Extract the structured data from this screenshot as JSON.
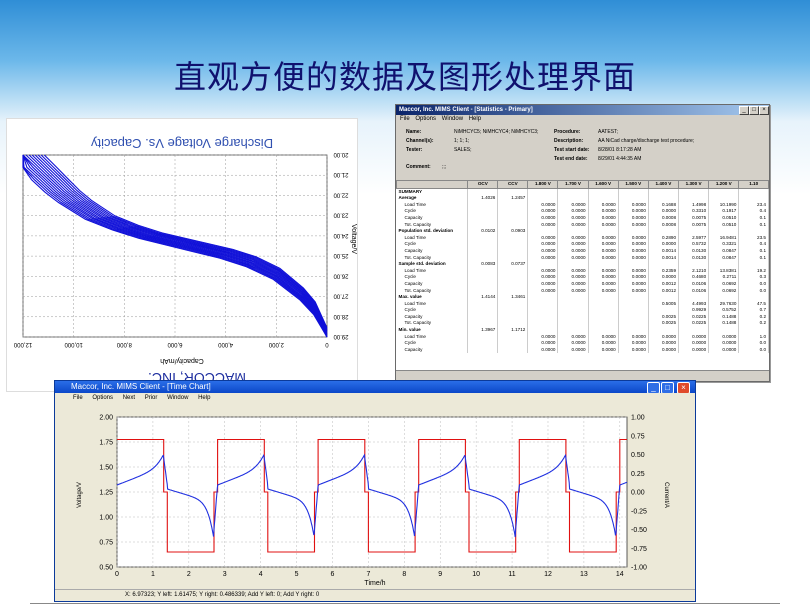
{
  "slide": {
    "title": "直观方便的数据及图形处理界面"
  },
  "discharge": {
    "title": "Discharge Voltage Vs. Capacity",
    "xlabel": "Capacity/mAh",
    "ylabel": "Voltage/V",
    "xticks": [
      "0",
      "2,000",
      "4,000",
      "6,000",
      "8,000",
      "10,000",
      "12,000"
    ],
    "yticks": [
      "20.00",
      "21.00",
      "22.00",
      "23.00",
      "24.00",
      "25.00",
      "26.00",
      "27.00",
      "28.00",
      "29.00"
    ],
    "watermark": "MACCOR, INC.",
    "line_color": "#1010d8"
  },
  "stats": {
    "window_title": "Maccor, Inc. MIMS Client - [Statistics - Primary]",
    "menu": [
      "File",
      "Options",
      "Window",
      "Help"
    ],
    "name_label": "Name:",
    "name_value": "NiMHCYC5; NiMHCYC4; NiMHCYC3;",
    "channels_label": "Channel(s):",
    "channels_value": "1; 1; 1;",
    "tester_label": "Tester:",
    "tester_value": "SALES;",
    "comment_label": "Comment:",
    "comment_value": ";;;",
    "procedure_label": "Procedure:",
    "procedure_value": "AATEST;",
    "description_label": "Description:",
    "description_value": "AA NiCad charge/discharge test procedure;",
    "start_label": "Test start date:",
    "start_value": "8/28/01 8:17:28 AM",
    "end_label": "Test end date:",
    "end_value": "8/29/01 4:44:35 AM",
    "columns": [
      "",
      "OCV",
      "CCV",
      "1.800 V",
      "1.700 V",
      "1.600 V",
      "1.500 V",
      "1.400 V",
      "1.300 V",
      "1.200 V",
      "1.10"
    ],
    "rows": [
      {
        "label": "SUMMARY",
        "sec": true,
        "cells": [
          "",
          "",
          "",
          "",
          "",
          "",
          "",
          "",
          "",
          ""
        ]
      },
      {
        "label": "Average",
        "sec": true,
        "cells": [
          "1.4026",
          "1.2457",
          "",
          "",
          "",
          "",
          "",
          "",
          "",
          ""
        ]
      },
      {
        "label": "Load Time",
        "cells": [
          "",
          "",
          "0.0000",
          "0.0000",
          "0.0000",
          "0.0000",
          "0.1688",
          "1.4998",
          "10.1990",
          "23.4"
        ]
      },
      {
        "label": "Cycle",
        "cells": [
          "",
          "",
          "0.0000",
          "0.0000",
          "0.0000",
          "0.0000",
          "0.0000",
          "0.3310",
          "0.1917",
          "0.4"
        ]
      },
      {
        "label": "Capacity",
        "cells": [
          "",
          "",
          "0.0000",
          "0.0000",
          "0.0000",
          "0.0000",
          "0.0008",
          "0.0075",
          "0.0510",
          "0.1"
        ]
      },
      {
        "label": "Tot. Capacity",
        "cells": [
          "",
          "",
          "0.0000",
          "0.0000",
          "0.0000",
          "0.0000",
          "0.0008",
          "0.0075",
          "0.0510",
          "0.1"
        ]
      },
      {
        "label": "Population std. deviation",
        "sec": true,
        "cells": [
          "0.0102",
          "0.0903",
          "",
          "",
          "",
          "",
          "",
          "",
          "",
          ""
        ]
      },
      {
        "label": "Load Time",
        "cells": [
          "",
          "",
          "0.0000",
          "0.0000",
          "0.0000",
          "0.0000",
          "0.2890",
          "2.5977",
          "16.9481",
          "23.5"
        ]
      },
      {
        "label": "Cycle",
        "cells": [
          "",
          "",
          "0.0000",
          "0.0000",
          "0.0000",
          "0.0000",
          "0.0000",
          "0.5732",
          "0.3321",
          "0.4"
        ]
      },
      {
        "label": "Capacity",
        "cells": [
          "",
          "",
          "0.0000",
          "0.0000",
          "0.0000",
          "0.0000",
          "0.0014",
          "0.0130",
          "0.0847",
          "0.1"
        ]
      },
      {
        "label": "Tot. Capacity",
        "cells": [
          "",
          "",
          "0.0000",
          "0.0000",
          "0.0000",
          "0.0000",
          "0.0014",
          "0.0130",
          "0.0847",
          "0.1"
        ]
      },
      {
        "label": "Sample std. deviation",
        "sec": true,
        "cells": [
          "0.0083",
          "0.0737",
          "",
          "",
          "",
          "",
          "",
          "",
          "",
          ""
        ]
      },
      {
        "label": "Load Time",
        "cells": [
          "",
          "",
          "0.0000",
          "0.0000",
          "0.0000",
          "0.0000",
          "0.2359",
          "2.1210",
          "13.8381",
          "19.2"
        ]
      },
      {
        "label": "Cycle",
        "cells": [
          "",
          "",
          "0.0000",
          "0.0000",
          "0.0000",
          "0.0000",
          "0.0000",
          "0.4680",
          "0.2711",
          "0.3"
        ]
      },
      {
        "label": "Capacity",
        "cells": [
          "",
          "",
          "0.0000",
          "0.0000",
          "0.0000",
          "0.0000",
          "0.0012",
          "0.0106",
          "0.0692",
          "0.0"
        ]
      },
      {
        "label": "Tot. Capacity",
        "cells": [
          "",
          "",
          "0.0000",
          "0.0000",
          "0.0000",
          "0.0000",
          "0.0012",
          "0.0106",
          "0.0692",
          "0.0"
        ]
      },
      {
        "label": "Max. value",
        "sec": true,
        "cells": [
          "1.4144",
          "1.3461",
          "",
          "",
          "",
          "",
          "",
          "",
          "",
          ""
        ]
      },
      {
        "label": "Load Time",
        "cells": [
          "",
          "",
          "",
          "",
          "",
          "",
          "0.5005",
          "4.4993",
          "29.7630",
          "47.5"
        ]
      },
      {
        "label": "Cycle",
        "cells": [
          "",
          "",
          "",
          "",
          "",
          "",
          "",
          "0.9929",
          "0.5752",
          "0.7"
        ]
      },
      {
        "label": "Capacity",
        "cells": [
          "",
          "",
          "",
          "",
          "",
          "",
          "0.0025",
          "0.0225",
          "0.1488",
          "0.2"
        ]
      },
      {
        "label": "Tot. Capacity",
        "cells": [
          "",
          "",
          "",
          "",
          "",
          "",
          "0.0025",
          "0.0225",
          "0.1488",
          "0.2"
        ]
      },
      {
        "label": "Min. value",
        "sec": true,
        "cells": [
          "1.3967",
          "1.1712",
          "",
          "",
          "",
          "",
          "",
          "",
          "",
          ""
        ]
      },
      {
        "label": "Load Time",
        "cells": [
          "",
          "",
          "0.0000",
          "0.0000",
          "0.0000",
          "0.0000",
          "0.0000",
          "0.0000",
          "0.0000",
          "1.0"
        ]
      },
      {
        "label": "Cycle",
        "cells": [
          "",
          "",
          "0.0000",
          "0.0000",
          "0.0000",
          "0.0000",
          "0.0000",
          "0.0000",
          "0.0000",
          "0.0"
        ]
      },
      {
        "label": "Capacity",
        "cells": [
          "",
          "",
          "0.0000",
          "0.0000",
          "0.0000",
          "0.0000",
          "0.0000",
          "0.0000",
          "0.0000",
          "0.0"
        ]
      }
    ]
  },
  "timechart": {
    "window_title": "Maccor, Inc. MIMS Client - [Time Chart]",
    "menu": [
      "File",
      "Options",
      "Next",
      "Prior",
      "Window",
      "Help"
    ],
    "status": "X: 6.97323; Y left: 1.61475; Y right: 0.486339; Add Y left: 0; Add Y right: 0",
    "xlabel": "Time/h",
    "ylabel_left": "Voltage/V",
    "ylabel_right": "Current/A",
    "xticks": [
      "0",
      "1",
      "2",
      "3",
      "4",
      "5",
      "6",
      "7",
      "8",
      "9",
      "10",
      "11",
      "12",
      "13",
      "14"
    ],
    "yleft_ticks": [
      "2.00",
      "1.75",
      "1.50",
      "1.25",
      "1.00",
      "0.75",
      "0.50"
    ],
    "yright_ticks": [
      "1.00",
      "0.75",
      "0.50",
      "0.25",
      "0.00",
      "-0.25",
      "-0.50",
      "-0.75",
      "-1.00"
    ],
    "voltage_color": "#2030e0",
    "current_color": "#e01010"
  },
  "chart_data": [
    {
      "type": "line",
      "title": "Discharge Voltage Vs. Capacity",
      "xlabel": "Capacity/mAh",
      "ylabel": "Voltage/V",
      "xlim": [
        12000,
        0
      ],
      "ylim": [
        20,
        29
      ],
      "series": [
        {
          "x": [
            0,
            500,
            1000,
            2000,
            3000,
            4000,
            5000,
            6000,
            7000,
            8000,
            9000,
            10000,
            10500,
            11000,
            11500,
            12000
          ],
          "values": [
            28.9,
            27.6,
            26.9,
            25.9,
            25.3,
            24.9,
            24.6,
            24.3,
            24.0,
            23.6,
            23.1,
            22.3,
            21.8,
            21.2,
            20.6,
            20.0
          ]
        }
      ]
    },
    {
      "type": "line",
      "title": "",
      "xlabel": "Time/h",
      "ylabel": "Voltage/V",
      "xlim": [
        0,
        14.2
      ],
      "ylim": [
        0.5,
        2.0
      ],
      "y2lim": [
        -1.0,
        1.0
      ],
      "series": [
        {
          "name": "",
          "axis": "left",
          "period_h": 2.8,
          "charge_voltage_end": 1.62,
          "rest_voltage": 1.35,
          "discharge_voltage_start": 1.25,
          "discharge_voltage_end": 0.82
        },
        {
          "name": "",
          "axis": "right",
          "levels_A": [
            0.7,
            0.0,
            -0.8,
            0.0
          ],
          "step_durations_h": [
            1.3,
            0.1,
            1.3,
            0.1
          ]
        }
      ]
    }
  ]
}
